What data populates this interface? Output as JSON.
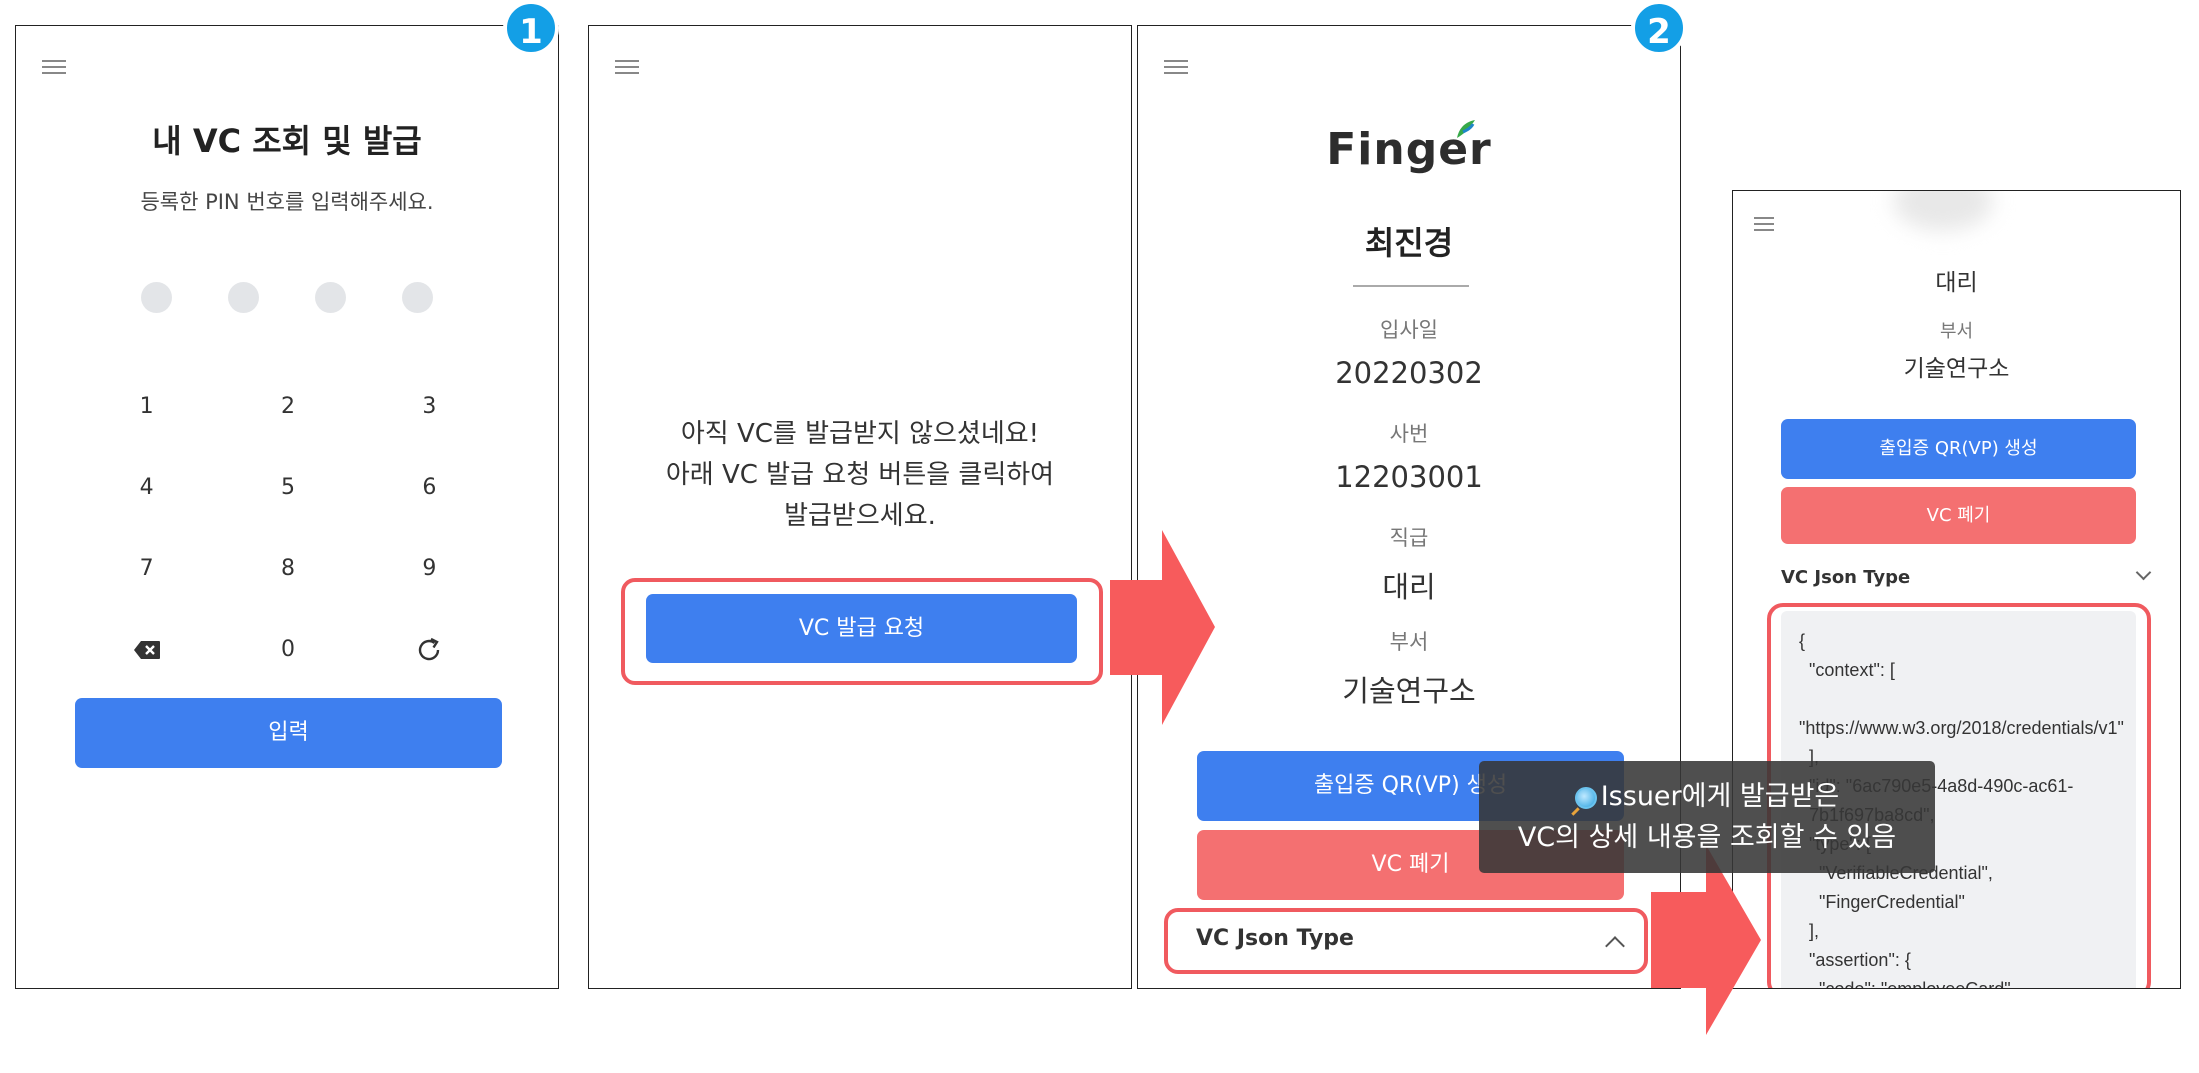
{
  "step_badges": {
    "step1": "1",
    "step2": "2"
  },
  "pin_screen": {
    "title": "내 VC 조회 및 발급",
    "subtitle": "등록한 PIN 번호를 입력해주세요.",
    "keypad": [
      "1",
      "2",
      "3",
      "4",
      "5",
      "6",
      "7",
      "8",
      "9",
      "0"
    ],
    "submit_label": "입력",
    "backspace_icon": "backspace-icon",
    "reset_icon": "refresh-icon"
  },
  "empty_screen": {
    "message_line1": "아직 VC를 발급받지 않으셨네요!",
    "message_line2": "아래 VC 발급 요청 버튼을 클릭하여",
    "message_line3": "발급받으세요.",
    "request_button": "VC 발급 요청"
  },
  "card_screen": {
    "logo_text": "Finger",
    "name": "최진경",
    "fields": [
      {
        "label": "입사일",
        "value": "20220302"
      },
      {
        "label": "사번",
        "value": "12203001"
      },
      {
        "label": "직급",
        "value": "대리"
      },
      {
        "label": "부서",
        "value": "기술연구소"
      }
    ],
    "qr_button": "출입증 QR(VP) 생성",
    "revoke_button": "VC 폐기",
    "json_toggle_label": "VC Json Type"
  },
  "detail_screen": {
    "rank_value": "대리",
    "dept_label": "부서",
    "dept_value": "기술연구소",
    "qr_button": "출입증 QR(VP) 생성",
    "revoke_button": "VC 폐기",
    "json_toggle_label": "VC Json Type",
    "json_text": "{\n  \"context\": [\n    \"https://www.w3.org/2018/credentials/v1\"\n  ],\n  \"id\": \"6ac790e5-4a8d-490c-ac61-\n  7b1f697ba8cd\",\n  \"type\": [\n    \"VerifiableCredential\",\n    \"FingerCredential\"\n  ],\n  \"assertion\": {\n    \"code\": \"employeeCard\""
  },
  "tooltip": {
    "line1": "Issuer에게 발급받은",
    "line2": "VC의 상세 내용을 조회할 수 있음"
  },
  "colors": {
    "primary": "#3e7fef",
    "danger": "#f47071",
    "highlight": "#f05a5f",
    "badge": "#139fe6"
  }
}
